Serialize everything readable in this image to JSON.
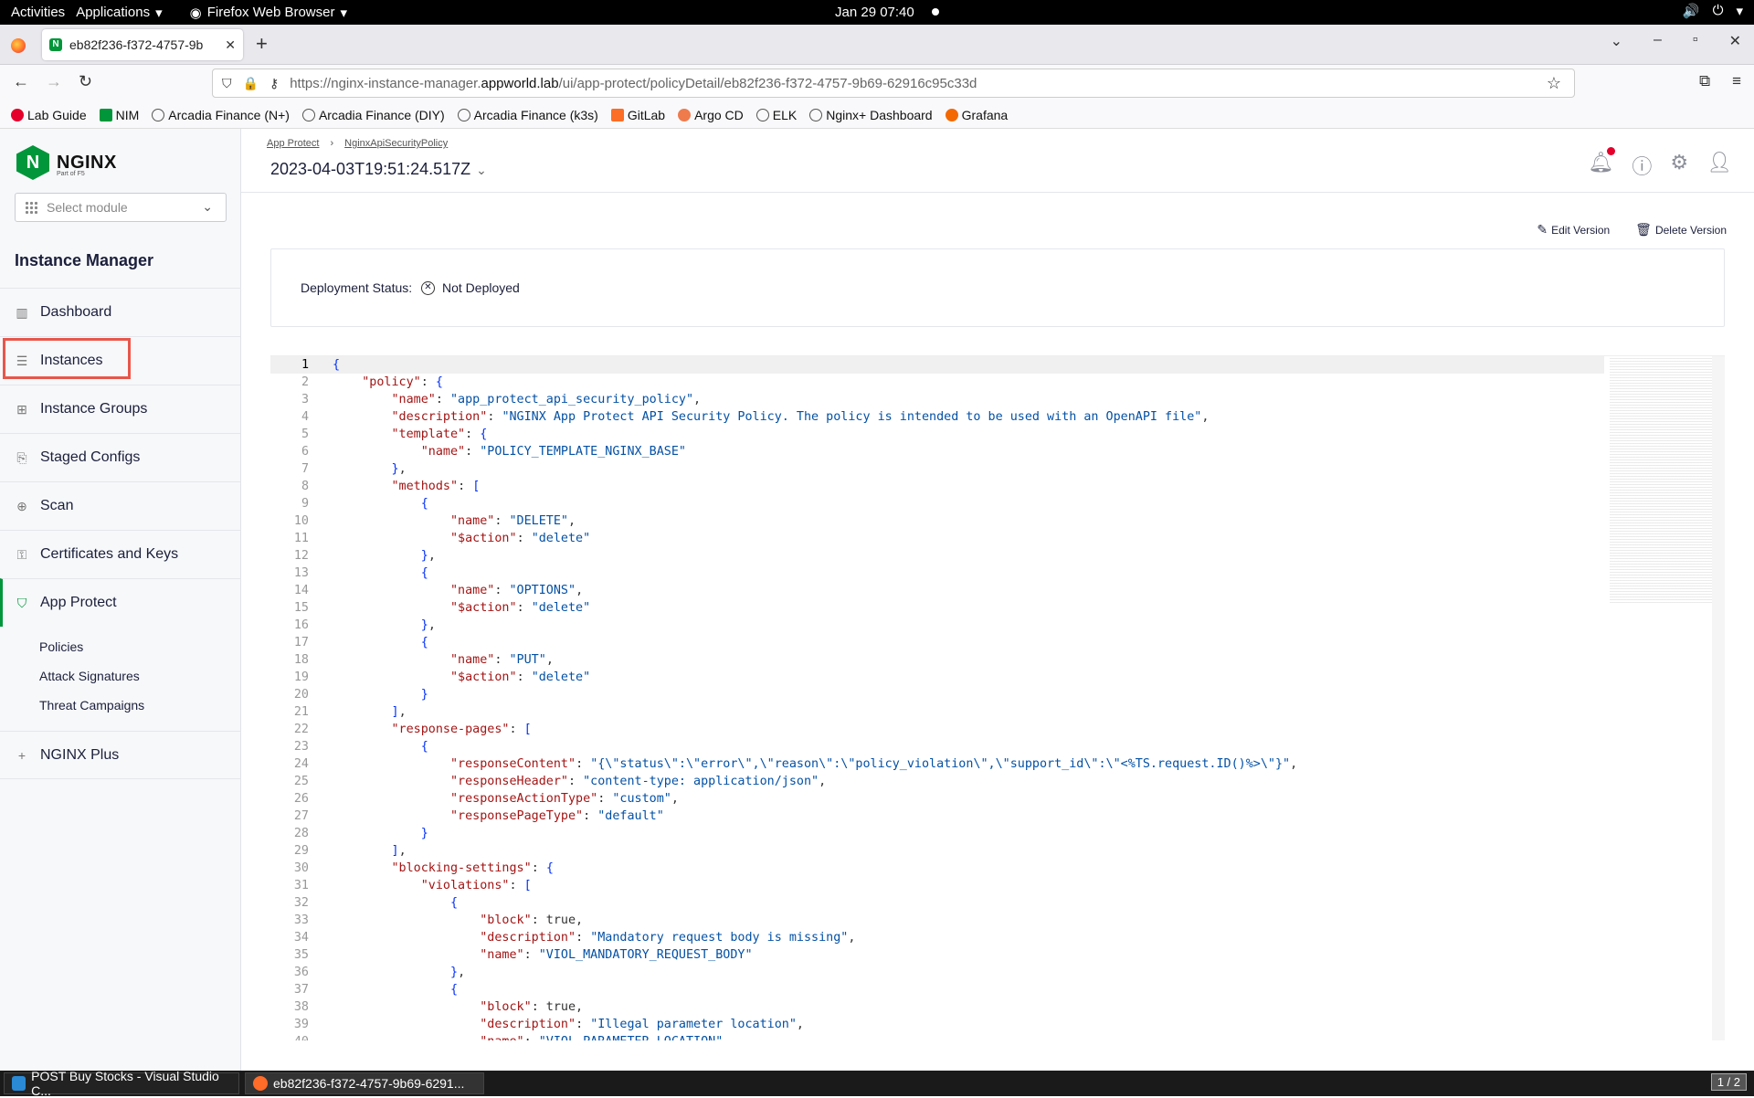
{
  "system": {
    "activities": "Activities",
    "applications": "Applications",
    "browser": "Firefox Web Browser",
    "clock": "Jan 29  07:40"
  },
  "browser": {
    "tab_title": "eb82f236-f372-4757-9b",
    "url_prefix": "https://nginx-instance-manager.",
    "url_host": "appworld.lab",
    "url_path": "/ui/app-protect/policyDetail/eb82f236-f372-4757-9b69-62916c95c33d",
    "bookmarks": [
      "Lab Guide",
      "NIM",
      "Arcadia Finance (N+)",
      "Arcadia Finance (DIY)",
      "Arcadia Finance (k3s)",
      "GitLab",
      "Argo CD",
      "ELK",
      "Nginx+ Dashboard",
      "Grafana"
    ]
  },
  "sidebar": {
    "brand": "NGINX",
    "brand_sub": "Part of F5",
    "module_placeholder": "Select module",
    "section_title": "Instance Manager",
    "items": [
      {
        "label": "Dashboard",
        "icon": "chart-icon"
      },
      {
        "label": "Instances",
        "icon": "server-icon"
      },
      {
        "label": "Instance Groups",
        "icon": "group-icon"
      },
      {
        "label": "Staged Configs",
        "icon": "staged-icon"
      },
      {
        "label": "Scan",
        "icon": "scan-icon"
      },
      {
        "label": "Certificates and Keys",
        "icon": "cert-icon"
      },
      {
        "label": "App Protect",
        "icon": "shield-icon"
      }
    ],
    "subitems": [
      "Policies",
      "Attack Signatures",
      "Threat Campaigns"
    ],
    "plus_item": "NGINX Plus"
  },
  "header": {
    "breadcrumb": [
      "App Protect",
      "NginxApiSecurityPolicy"
    ],
    "version": "2023-04-03T19:51:24.517Z"
  },
  "actions": {
    "edit": "Edit Version",
    "delete": "Delete Version"
  },
  "status": {
    "label": "Deployment Status:",
    "value": "Not Deployed"
  },
  "code_lines": [
    "{",
    "    \"policy\": {",
    "        \"name\": \"app_protect_api_security_policy\",",
    "        \"description\": \"NGINX App Protect API Security Policy. The policy is intended to be used with an OpenAPI file\",",
    "        \"template\": {",
    "            \"name\": \"POLICY_TEMPLATE_NGINX_BASE\"",
    "        },",
    "        \"methods\": [",
    "            {",
    "                \"name\": \"DELETE\",",
    "                \"$action\": \"delete\"",
    "            },",
    "            {",
    "                \"name\": \"OPTIONS\",",
    "                \"$action\": \"delete\"",
    "            },",
    "            {",
    "                \"name\": \"PUT\",",
    "                \"$action\": \"delete\"",
    "            }",
    "        ],",
    "        \"response-pages\": [",
    "            {",
    "                \"responseContent\": \"{\\\"status\\\":\\\"error\\\",\\\"reason\\\":\\\"policy_violation\\\",\\\"support_id\\\":\\\"<%TS.request.ID()%>\\\"}\",",
    "                \"responseHeader\": \"content-type: application/json\",",
    "                \"responseActionType\": \"custom\",",
    "                \"responsePageType\": \"default\"",
    "            }",
    "        ],",
    "        \"blocking-settings\": {",
    "            \"violations\": [",
    "                {",
    "                    \"block\": true,",
    "                    \"description\": \"Mandatory request body is missing\",",
    "                    \"name\": \"VIOL_MANDATORY_REQUEST_BODY\"",
    "                },",
    "                {",
    "                    \"block\": true,",
    "                    \"description\": \"Illegal parameter location\",",
    "                    \"name\": \"VIOL_PARAMETER_LOCATION\""
  ],
  "taskbar": [
    {
      "label": "POST Buy Stocks - Visual Studio C..."
    },
    {
      "label": "eb82f236-f372-4757-9b69-6291..."
    }
  ],
  "pager": "1 / 2"
}
